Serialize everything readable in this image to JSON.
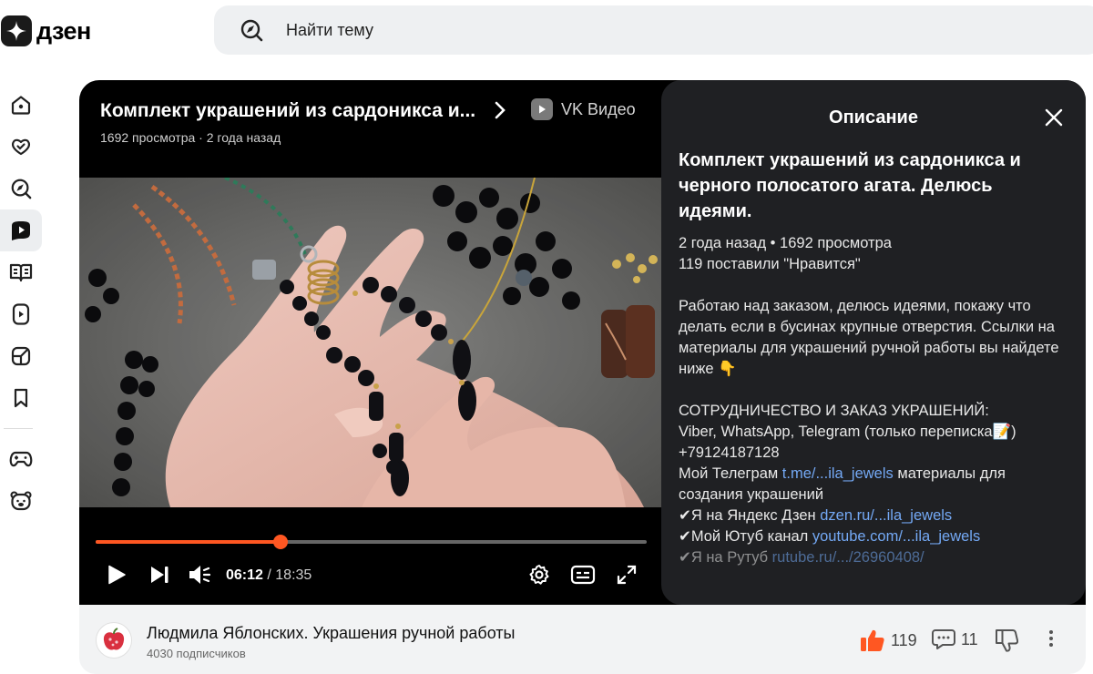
{
  "header": {
    "logo_text": "дзен",
    "search_placeholder": "Найти тему"
  },
  "sidebar": {
    "items": [
      {
        "icon": "home-icon"
      },
      {
        "icon": "heart-check-icon"
      },
      {
        "icon": "compass-icon"
      },
      {
        "icon": "video-icon",
        "active": true
      },
      {
        "icon": "book-icon"
      },
      {
        "icon": "shorts-icon"
      },
      {
        "icon": "cube-icon"
      },
      {
        "icon": "bookmark-icon"
      },
      {
        "icon": "gamepad-icon"
      },
      {
        "icon": "bear-icon"
      }
    ]
  },
  "player": {
    "title": "Комплект украшений из сардоникса и...",
    "source": "VK Видео",
    "meta": "1692 просмотра · 2 года назад",
    "current_time": "06:12",
    "total_time": "/ 18:35",
    "progress": 0.335,
    "accent_color": "#ff5722"
  },
  "description": {
    "header": "Описание",
    "title": "Комплект украшений из сардоникса и черного полосатого агата. Делюсь идеями.",
    "stats_line1": "2 года назад • 1692 просмотра",
    "stats_line2": "119 поставили \"Нравится\"",
    "paragraph": "Работаю над заказом, делюсь идеями, покажу что делать если в бусинах крупные отверстия. Ссылки на материалы для украшений ручной работы вы найдете ниже 👇",
    "coop_title": "СОТРУДНИЧЕСТВО И ЗАКАЗ УКРАШЕНИЙ:",
    "coop_line": "Viber, WhatsApp, Telegram (только переписка📝)",
    "phone": "+79124187128",
    "tg_prefix": "Мой Телеграм ",
    "tg_link": "t.me/...ila_jewels",
    "tg_suffix": " материалы для создания украшений",
    "dzen_prefix": "✔Я на Яндекс Дзен ",
    "dzen_link": "dzen.ru/...ila_jewels",
    "yt_prefix": "✔Мой Ютуб канал ",
    "yt_link": "youtube.com/...ila_jewels",
    "rt_prefix": "✔Я на Рутуб ",
    "rt_link": "rutube.ru/.../26960408/"
  },
  "channel": {
    "name": "Людмила Яблонских. Украшения ручной работы",
    "subscribers": "4030 подписчиков",
    "likes": "119",
    "comments": "11"
  }
}
